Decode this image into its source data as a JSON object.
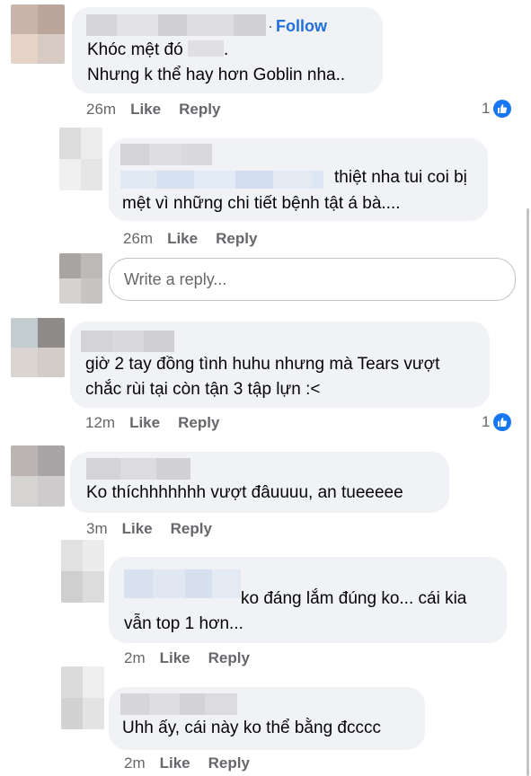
{
  "follow_label": "Follow",
  "reply_placeholder": "Write a reply...",
  "like_label": "Like",
  "reply_label": "Reply",
  "colors": {
    "bubble": "#f0f2f5",
    "link": "#216fdb",
    "meta": "#65676b",
    "like_badge": "#1877f2"
  },
  "comments": [
    {
      "line1": "Khóc mệt đó",
      "line1_tail": ".",
      "line2": "Nhưng k thể hay hơn Goblin nha..",
      "time": "26m",
      "likes": "1"
    },
    {
      "line1": "thiệt nha tui coi bị",
      "line2": "mệt vì những chi tiết bệnh tật á bà....",
      "time": "26m"
    },
    {
      "line1": "giờ 2 tay đồng tình huhu nhưng mà Tears vượt",
      "line2": "chắc rùi tại còn tận 3 tập lựn :<",
      "time": "12m",
      "likes": "1"
    },
    {
      "line1": "Ko thíchhhhhhh vượt đâuuuu, an tueeeee",
      "time": "3m"
    },
    {
      "line1": "ko đáng lắm đúng ko... cái kia",
      "line2": "vẫn top 1 hơn...",
      "time": "2m"
    },
    {
      "line1": "Uhh ấy, cái này ko thể bằng đcccc",
      "time": "2m"
    }
  ]
}
